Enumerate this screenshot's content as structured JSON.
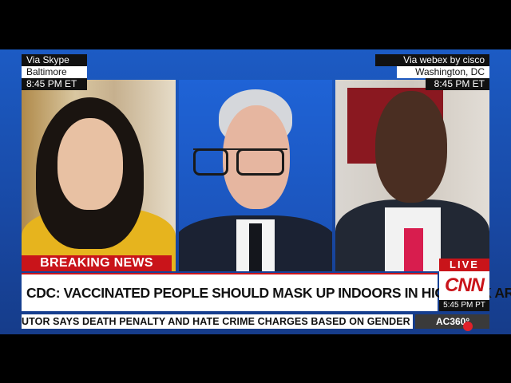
{
  "left_panel": {
    "via": "Via Skype",
    "location": "Baltimore",
    "time": "8:45 PM ET"
  },
  "right_panel": {
    "via": "Via webex by cisco",
    "location": "Washington, DC",
    "time": "8:45 PM ET"
  },
  "lower_third": {
    "breaking": "BREAKING NEWS",
    "headline": "CDC: VACCINATED PEOPLE SHOULD MASK UP INDOORS IN HIGH-RISK AREAS",
    "live": "LIVE",
    "network": "CNN",
    "clock": "5:45 PM PT",
    "ticker": "UTOR SAYS DEATH PENALTY AND HATE CRIME CHARGES BASED ON GENDER",
    "show": "AC360°"
  },
  "colors": {
    "cnn_red": "#c9141a",
    "studio_blue": "#1c5bc4"
  }
}
